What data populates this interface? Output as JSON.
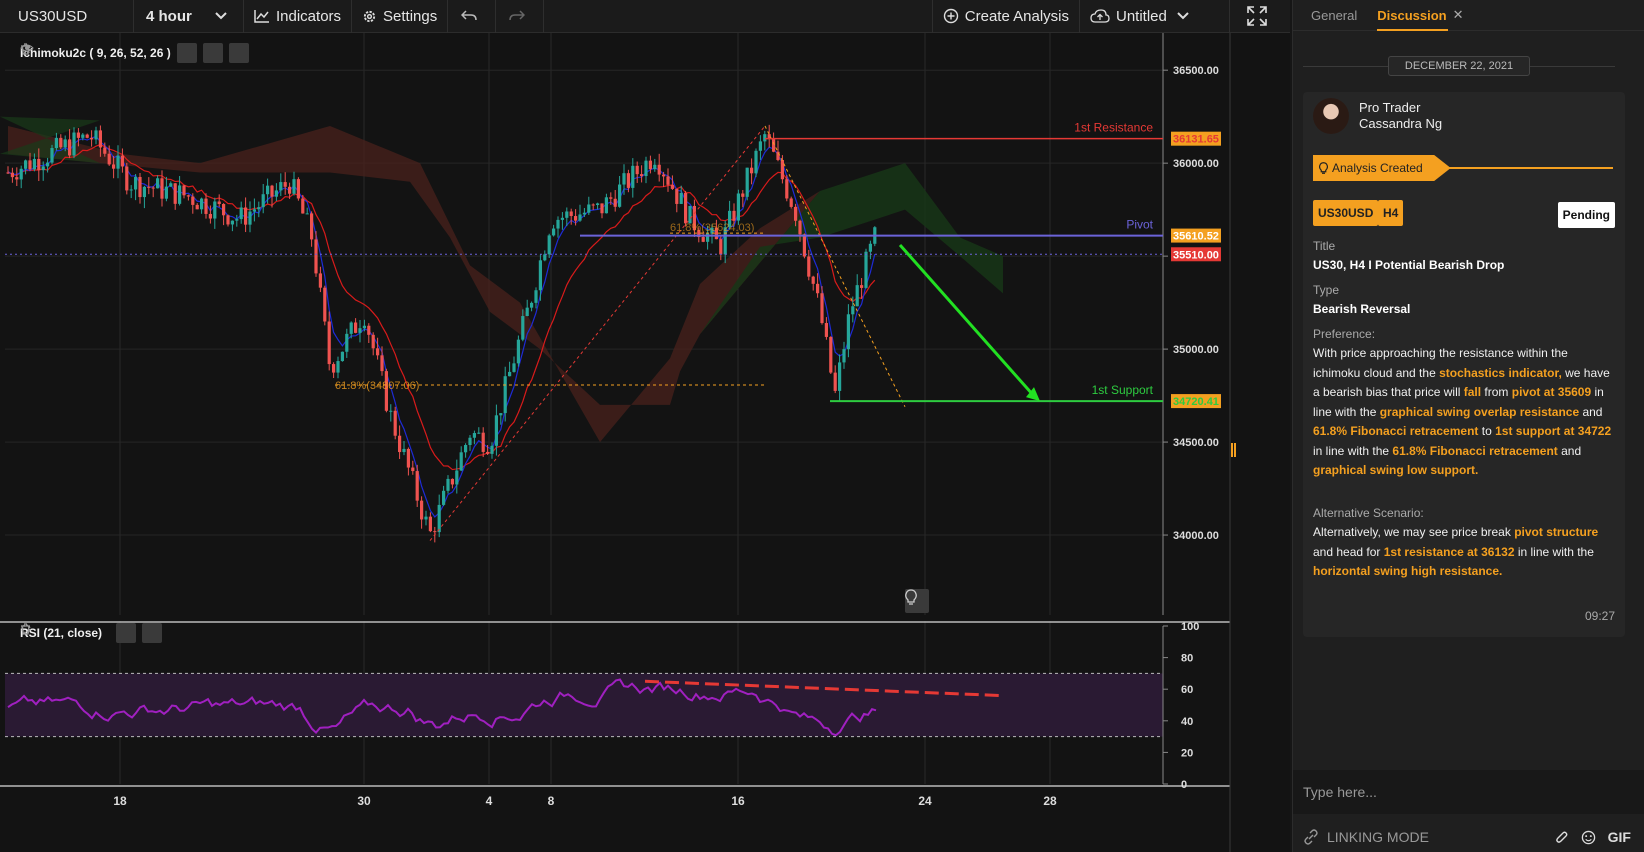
{
  "toolbar": {
    "symbol": "US30USD",
    "interval": "4 hour",
    "indicators_label": "Indicators",
    "settings_label": "Settings",
    "create_analysis_label": "Create Analysis",
    "layout_name": "Untitled"
  },
  "chart": {
    "main_indicator": "Ichimoku2c ( 9, 26, 52, 26 )",
    "rsi_indicator": "RSI (21, close)",
    "price_labels": [
      "36500.00",
      "36000.00",
      "35500.00",
      "35000.00",
      "34500.00",
      "34000.00"
    ],
    "price_values": [
      36500,
      36000,
      35500,
      35000,
      34500,
      34000
    ],
    "price_range": [
      33570,
      36700
    ],
    "rsi_labels": [
      "100",
      "80",
      "60",
      "40",
      "20",
      "0"
    ],
    "rsi_values": [
      100,
      80,
      60,
      40,
      20,
      0
    ],
    "x_labels": [
      "18",
      "30",
      "4",
      "8",
      "16",
      "24",
      "28"
    ],
    "levels": [
      {
        "name": "1st Resistance",
        "price_label": "36131.65",
        "value": 36131.65,
        "color": "#e53935"
      },
      {
        "name": "Pivot",
        "price_label": "35610.52",
        "value": 35610.52,
        "color": "#6b63d9"
      },
      {
        "name": "",
        "price_label": "35510.00",
        "value": 35510.0,
        "color": "#e53935"
      },
      {
        "name": "1st Support",
        "price_label": "34720.41",
        "value": 34720.41,
        "color": "#2ecc40"
      }
    ],
    "fib_labels": [
      "61.8%(35624.03)",
      "61.8%(34807.06)"
    ],
    "colors": {
      "up": "#26a69a",
      "down": "#ef5350",
      "tenkan": "#1e2bd6",
      "kijun": "#d81b1b",
      "label_bg": "#f4a020"
    }
  },
  "panel": {
    "tabs": [
      "General",
      "Discussion"
    ],
    "active_tab": "Discussion",
    "date": "DECEMBER 22, 2021",
    "author_role": "Pro Trader",
    "author_name": "Cassandra Ng",
    "status": "Analysis Created",
    "tags": [
      "US30USD",
      "H4"
    ],
    "pending": "Pending",
    "title_label": "Title",
    "title_value": "US30, H4 I Potential Bearish Drop",
    "type_label": "Type",
    "type_value": "Bearish Reversal",
    "preference_label": "Preference:",
    "preference_text": [
      {
        "t": "With price approaching the resistance within the ichimoku cloud and the ",
        "h": false
      },
      {
        "t": "stochastics indicator,",
        "h": true
      },
      {
        "t": " we have a bearish bias that price will ",
        "h": false
      },
      {
        "t": "fall",
        "h": true
      },
      {
        "t": " from ",
        "h": false
      },
      {
        "t": "pivot at 35609",
        "h": true
      },
      {
        "t": " in line with the ",
        "h": false
      },
      {
        "t": "graphical swing overlap resistance",
        "h": true
      },
      {
        "t": " and ",
        "h": false
      },
      {
        "t": "61.8% Fibonacci retracement",
        "h": true
      },
      {
        "t": " to ",
        "h": false
      },
      {
        "t": "1st support at 34722",
        "h": true
      },
      {
        "t": " in line with the ",
        "h": false
      },
      {
        "t": "61.8% Fibonacci retracement",
        "h": true
      },
      {
        "t": " and ",
        "h": false
      },
      {
        "t": "graphical swing low support.",
        "h": true
      }
    ],
    "alt_label": "Alternative Scenario:",
    "alt_text": [
      {
        "t": "Alternatively, we may see price break ",
        "h": false
      },
      {
        "t": "pivot structure",
        "h": true
      },
      {
        "t": " and head for ",
        "h": false
      },
      {
        "t": "1st resistance at 36132",
        "h": true
      },
      {
        "t": " in line with the ",
        "h": false
      },
      {
        "t": "horizontal swing high resistance.",
        "h": true
      }
    ],
    "time": "09:27",
    "input_placeholder": "Type here...",
    "linking_mode": "LINKING MODE",
    "gif_label": "GIF"
  }
}
